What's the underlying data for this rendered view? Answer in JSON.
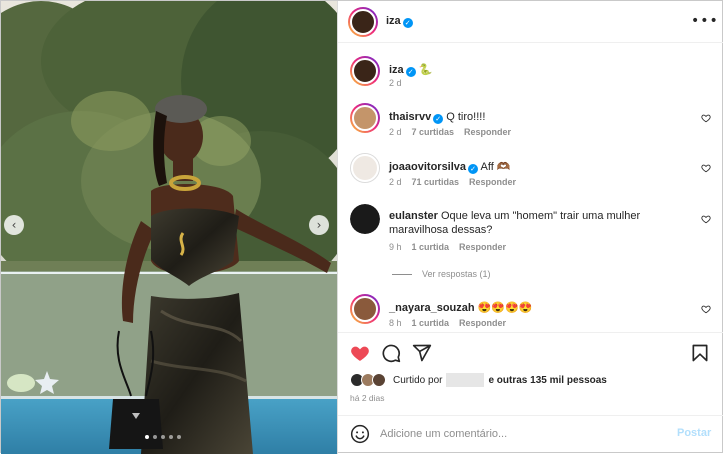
{
  "post": {
    "author": "iza",
    "verified": true,
    "more_label": "•••",
    "photo": {
      "nav_prev": "‹",
      "nav_next": "›",
      "slide_count": 5,
      "active_slide": 1
    }
  },
  "caption": {
    "username": "iza",
    "text": "🐍",
    "time": "2 d"
  },
  "comments": [
    {
      "username": "thaisrvv",
      "verified": true,
      "text": "Q tiro!!!!",
      "time": "2 d",
      "likes": "7 curtidas",
      "reply": "Responder"
    },
    {
      "username": "joaaovitorsilva",
      "verified": true,
      "text": "Aff 🫶🏾",
      "time": "2 d",
      "likes": "71 curtidas",
      "reply": "Responder"
    },
    {
      "username": "eulanster",
      "verified": false,
      "text": "Oque leva um \"homem\" trair uma mulher maravilhosa dessas?",
      "time": "9 h",
      "likes": "1 curtida",
      "reply": "Responder"
    },
    {
      "username": "_nayara_souzah",
      "verified": false,
      "text": "😍😍😍😍",
      "time": "8 h",
      "likes": "1 curtida",
      "reply": "Responder"
    }
  ],
  "view_replies": "Ver respostas (1)",
  "actions": {
    "liked_by_prefix": "Curtido por",
    "liked_by_suffix": "e outras 135 mil pessoas",
    "time": "há 2 dias"
  },
  "add_comment": {
    "placeholder": "Adicione um comentário...",
    "post_label": "Postar"
  },
  "colors": {
    "like_red": "#ed4956",
    "verified_blue": "#0095f6",
    "meta_gray": "#8e8e8e",
    "post_disabled": "#b2dffc"
  }
}
